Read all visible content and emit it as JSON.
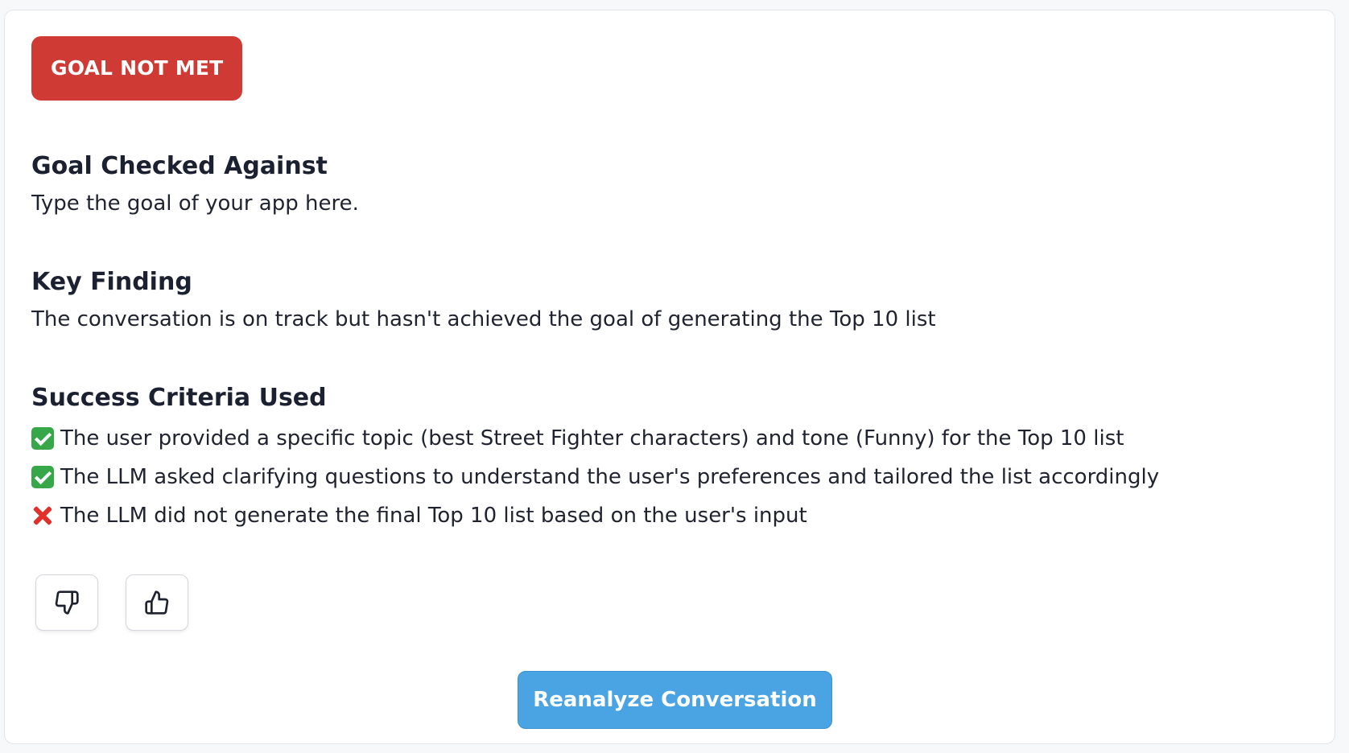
{
  "status_badge": "GOAL NOT MET",
  "colors": {
    "badge_background": "#cf3b34",
    "primary_button": "#4aa3e3",
    "success": "#37a84a",
    "failure": "#e0302b"
  },
  "goal": {
    "heading": "Goal Checked Against",
    "text": "Type the goal of your app here."
  },
  "finding": {
    "heading": "Key Finding",
    "text": "The conversation is on track but hasn't achieved the goal of generating the Top 10 list"
  },
  "criteria": {
    "heading": "Success Criteria Used",
    "items": [
      {
        "status": "met",
        "icon": "check-mark-icon",
        "text": "The user provided a specific topic (best Street Fighter characters) and tone (Funny) for the Top 10 list"
      },
      {
        "status": "met",
        "icon": "check-mark-icon",
        "text": "The LLM asked clarifying questions to understand the user's preferences and tailored the list accordingly"
      },
      {
        "status": "not_met",
        "icon": "cross-mark-icon",
        "text": "The LLM did not generate the final Top 10 list based on the user's input"
      }
    ]
  },
  "feedback": {
    "thumbs_down_icon": "thumbs-down-icon",
    "thumbs_up_icon": "thumbs-up-icon"
  },
  "reanalyze_label": "Reanalyze Conversation"
}
